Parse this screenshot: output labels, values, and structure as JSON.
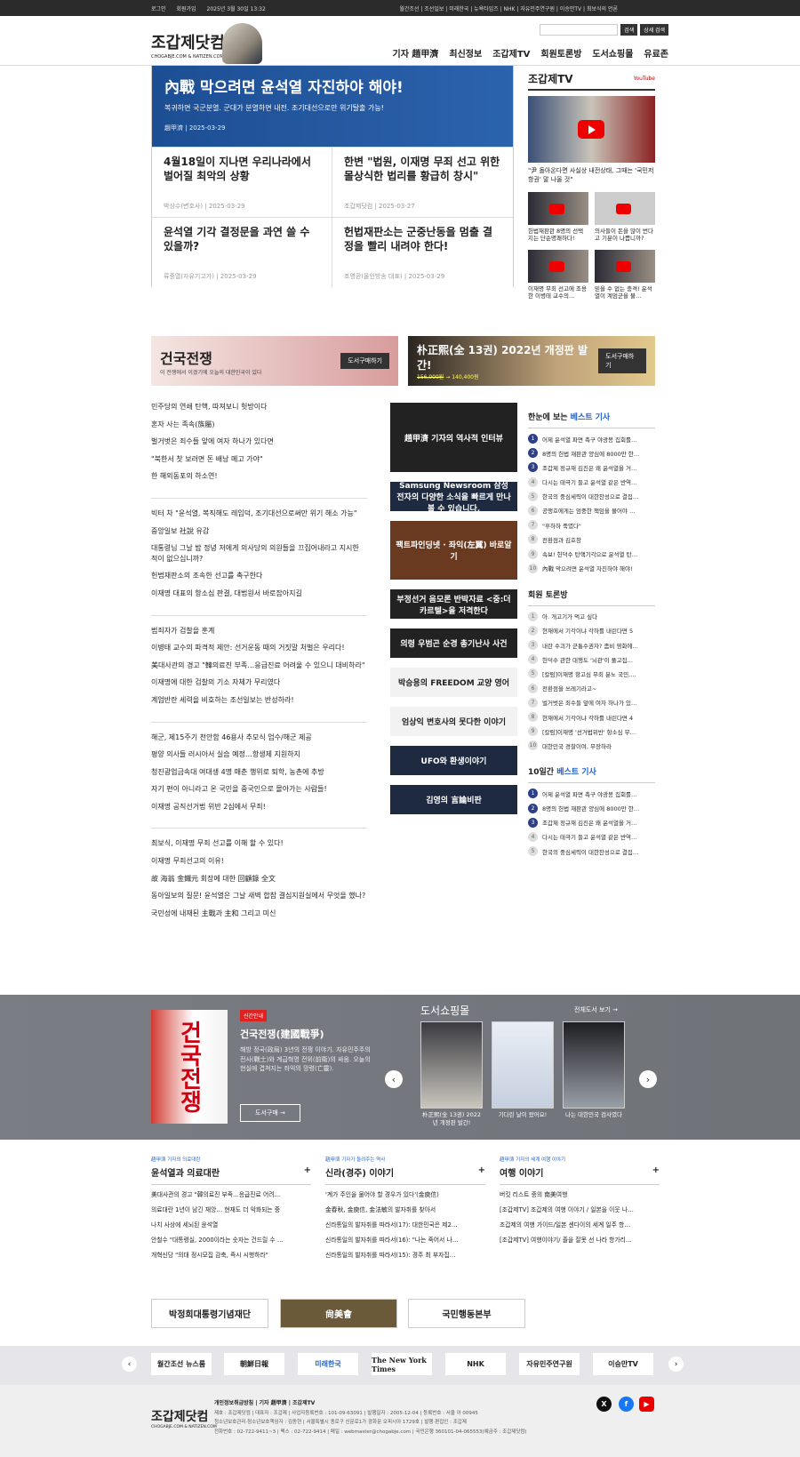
{
  "topbar": {
    "login": "로그인",
    "join": "회원가입",
    "date": "2025년 3월 30일 13:32",
    "links": "월간조선 | 조선일보 | 미래한국 | 뉴욕타임즈 | NHK | 자유민주연구원 | 이승만TV | 최보식의 언론"
  },
  "header": {
    "logo": "조갑제닷컴",
    "logo_sub": "CHOGABJE.COM & NATIZEN.COM",
    "search_btn": "검색",
    "detail_btn": "상세 검색",
    "nav": [
      "기자 趙甲濟",
      "최신정보",
      "조갑제TV",
      "회원토론방",
      "도서쇼핑몰",
      "유료존"
    ]
  },
  "feature": {
    "title": "內戰 막으려면 윤석열 자진하야 해야!",
    "summary": "복귀하면 국군분열. 군대가 분열하면 내전. 조기대선으로만 위기탈출 가능!",
    "byline": "趙甲濟",
    "date": "2025-03-29",
    "items": [
      {
        "title": "4월18일이 지나면 우리나라에서 벌어질 최악의 상황",
        "author": "박상수(변호사)",
        "date": "2025-03-29"
      },
      {
        "title": "한변 \"법원, 이재명 무죄 선고 위한 몰상식한 법리를 황급히 창시\"",
        "author": "조갑제닷컴",
        "date": "2025-03-27"
      },
      {
        "title": "윤석열 기각 결정문을 과연 쓸 수 있을까?",
        "author": "류중열(자유기고가)",
        "date": "2025-03-29"
      },
      {
        "title": "헌법재판소는 군중난동을 멈출 결정을 빨리 내려야 한다!",
        "author": "조영환(올인방송 대표)",
        "date": "2025-03-29"
      }
    ]
  },
  "tv": {
    "title": "조갑제TV",
    "youtube": "YouTube",
    "main_caption": "\"尹 돌아온다면 사실상 내전상태, 그때는 '국민저항권' 말 나올 것\"",
    "items": [
      "헌법재판관 8명의 선택지는 단순명쾌하다!",
      "의사들이 돈을 많이 번다고 기분이 나쁩니까?",
      "이재명 무죄 선고에 조용한 이병태 교수의…",
      "믿을 수 없는 충격! 윤석열이 계엄군을 불…"
    ]
  },
  "banners": [
    {
      "title": "건국전쟁",
      "sub": "이 전쟁에서 이겼기에 오늘의 대한민국이 있다",
      "button": "도서구매하기"
    },
    {
      "title": "朴正熙(全 13권) 2022년 개정판 발간!",
      "price_old": "156,000원",
      "price_new": "140,400원",
      "button": "도서구매하기"
    }
  ],
  "headlines": [
    [
      "민주당의 연쇄 탄핵, 따져보니 헛방이다",
      "혼자 사는 족속(族屬)",
      "벌거벗은 죄수들 앞에 여자 하나가 있다면",
      "\"북한서 찻 보러면 돈 배낭 메고 가야\"",
      "한 해외동포의 하소연!"
    ],
    [
      "빅터 차 \"윤석열, 복직해도 레임덕, 조기대선으로써만 위기 해소 가능\"",
      "중앙일보 社說 유감",
      "대통령님 그날 밤 정녕 저에게 의사당의 의원들을 끄집어내라고 지시한 적이 없으십니까?",
      "헌법재판소의 조속한 선고를 촉구한다",
      "이재명 대표의 항소심 판결, 대법원서 바로잡아지길"
    ],
    [
      "범죄자가 검찰을 훈계",
      "이병태 교수의 파격적 제안: 선거운동 때의 거짓말 처벌은 우리다!",
      "美대사관의 경고 \"韓의료진 부족…응급진료 어려울 수 있으니 대비하라\"",
      "이재명에 대한 검찰의 기소 자체가 무리였다",
      "계엄반란 세력을 비호하는 조선일보는 반성하라!"
    ],
    [
      "해군, 제15주기 천안함 46용사 추모식 엄수/해군 제공",
      "평양 의사들 러시아서 실습 예정…항생제 지원하지",
      "청진광업금속대 여대생 4명 매춘 행위로 퇴학, 농촌에 추방",
      "자기 편이 아니라고 온 국민을 중국인으로 몰아가는 사람들!",
      "이재명 공직선거법 위반 2심에서 무죄!"
    ],
    [
      "최보식, 이재명 무죄 선고를 이해 할 수 있다!",
      "이재명 무죄선고의 이유!",
      "故 海翁 金鐵元 회장에 대한 回顧錄 全文",
      "동아일보의 질문! 윤석열은 그날 새벽 합참 결심지원실에서 무엇을 했나?",
      "국민성에 내재된 主戰과 主和 그리고 미신"
    ]
  ],
  "ads": [
    "趙甲濟 기자의 역사적 인터뷰",
    "Samsung Newsroom 삼성전자의 다양한 소식을 빠르게 만나볼 수 있습니다.",
    "팩트파인딩넷 · 좌익(左翼) 바로알기",
    "부정선거 음모론 반박자료 <중:더 카르텔>을 저격한다",
    "의령 우범곤 순경 총기난사 사건",
    "박승용의 FREEDOM 교양 영어",
    "엄상익 변호사의 못다한 이야기",
    "UFO와 환생이야기",
    "김영의 言論비판"
  ],
  "best": {
    "title1": "한눈에 보는 ",
    "title2": "베스트 기사",
    "items": [
      "어제 윤석열 파면 촉구 야광봉 집회를…",
      "8명의 헌법 재판관 양심에 8000만 한…",
      "조갑제 정규재 김진은 왜 윤석열을 거…",
      "다시는 태극기 들고 윤석열 같은 반역…",
      "한국의 중심세력이 대한찬성으로 결집…",
      "공맹호에게는 엄중한 책임을 물어야 …",
      "\"후하하 죽였다\"",
      "전환점과 김호창",
      "속보! 헌덕수 탄핵기각으로 윤석열 탄…",
      "內戰 막으려면 윤석열 자진하야 해야!"
    ]
  },
  "forum": {
    "title": "회원 토론방",
    "items": [
      "아. 개고기가 먹고 싶다",
      "현재에서 기각이냐 각하를 내린다면 5",
      "내란 수괴가 군통수권자? 좀비 영화에…",
      "헌덕수 관한 대행도 '뇌관'이 풀고집…",
      "[칼럼]이재명 항고심 무죄 분노 국민,…",
      "전환점을 쓰레기라고~",
      "벌거벗은 죄수들 앞에 여자 하나가 있…",
      "현재에서 기각이냐 각하를 내린다면 4",
      "[칼럼]이재명 '선거법위반' 항소심 무…",
      "대한민국 경찰이여, 무장하라"
    ]
  },
  "best10": {
    "title1": "10일간 ",
    "title2": "베스트 기사",
    "items": [
      "어제 윤석열 파면 촉구 야광봉 집회를…",
      "8명의 헌법 재판관 양심에 8000만 한…",
      "조갑제 정규재 김진은 왜 윤석열을 거…",
      "다시는 태극기 들고 윤석열 같은 반역…",
      "한국의 중심세력이 대한찬성으로 결집…"
    ]
  },
  "newbook": {
    "tag": "신간안내",
    "cover_text": "건국전쟁",
    "title": "건국전쟁(建國戰爭)",
    "desc": "해방 정국(政局) 3년의 전쟁 이야기. 자유민주주의 전사(戰士)와 계급혁명 전위(前衛)의 싸움. 오늘의 현실에 겹쳐지는 좌익의 망령(亡靈).",
    "button": "도서구매 →"
  },
  "shop": {
    "title": "도서쇼핑몰",
    "all": "전체도서 보기 →",
    "books": [
      "朴正熙(全 13권) 2022년 개정판 발간!",
      "기다린 날이 왔어요!",
      "나는 대한민국 검사였다"
    ]
  },
  "columns": [
    {
      "kicker": "趙甲濟 기자의 의료대란",
      "title": "윤석열과 의료대란",
      "items": [
        "美대사관의 경고 \"韓의료진 부족…응급진료 어려…",
        "의료대란 1년이 남긴 재앙… 현재도 더 악화되는 중",
        "나치 사상에 세뇌된 윤석열",
        "안철수 \"대통령실, 2000이라는 숫자는 건드릴 수 …",
        "개혁신당 \"의대 정시모집 감축, 즉시 시행하라\""
      ]
    },
    {
      "kicker": "趙甲濟 기자가 들려주는 역사",
      "title": "신라(경주) 이야기",
      "items": [
        "'계가 주인을 물어야 할 경우가 있다'(金庾信)",
        "金春秋, 金庾信, 金法敏의 발자취를 찾아서",
        "신라통일의 발자취를 따라서(17): 대한민국은 제2…",
        "신라통일의 발자취를 따라서(16): \"나는 죽어서 나…",
        "신라통일의 발자취를 따라서(15): 경주 최 부자집…"
      ]
    },
    {
      "kicker": "趙甲濟 기자의 세계 여행 이야기",
      "title": "여행 이야기",
      "items": [
        "버킷 리스트 중의 南美여행",
        "[조갑제TV] 조갑제의 여행 이야기 / 일본을 이웃 나…",
        "조갑제의 여행 가이드/일본 센다이의 세계 일주 항…",
        "[조갑제TV] 여행이야기/ 졸을 잘못 선 나라 항가리…"
      ]
    }
  ],
  "partners": [
    "박정희대통령기념재단",
    "尙美會",
    "국민행동본부"
  ],
  "links": [
    "월간조선 뉴스룸",
    "朝鮮日報",
    "미래한국",
    "The New York Times",
    "NHK",
    "자유민주연구원",
    "이승만TV"
  ],
  "footer": {
    "logo": "조갑제닷컴",
    "logo_sub": "CHOGABJE.COM & NATIZEN.COM",
    "links": "개인정보취급방침 | 기자 趙甲濟 | 조갑제TV",
    "lines": [
      "제호 : 조갑제닷컴 | 대표자 : 조갑제 | 사업자등록번호 : 101-09-63091 | 발행일자 : 2005-12-04 | 등록번호 : 서울 아 00945",
      "청소년보호관리·청소년보호책임자 : 김동현 | 서울특별시 종로구 신문로1가 광화문 오피시아 1729호 | 발행·편집인 : 조갑제",
      "전화번호 : 02-722-9411~3 | 팩스 : 02-722-9414 | 메일 : webmaster@chogabje.com | 국민은행 360101-04-065553(예금주 : 조갑제닷컴)"
    ]
  },
  "colors": {
    "accent": "#2563c9",
    "feature_bg": "#1c4e93",
    "hot": "#2d3f86"
  }
}
